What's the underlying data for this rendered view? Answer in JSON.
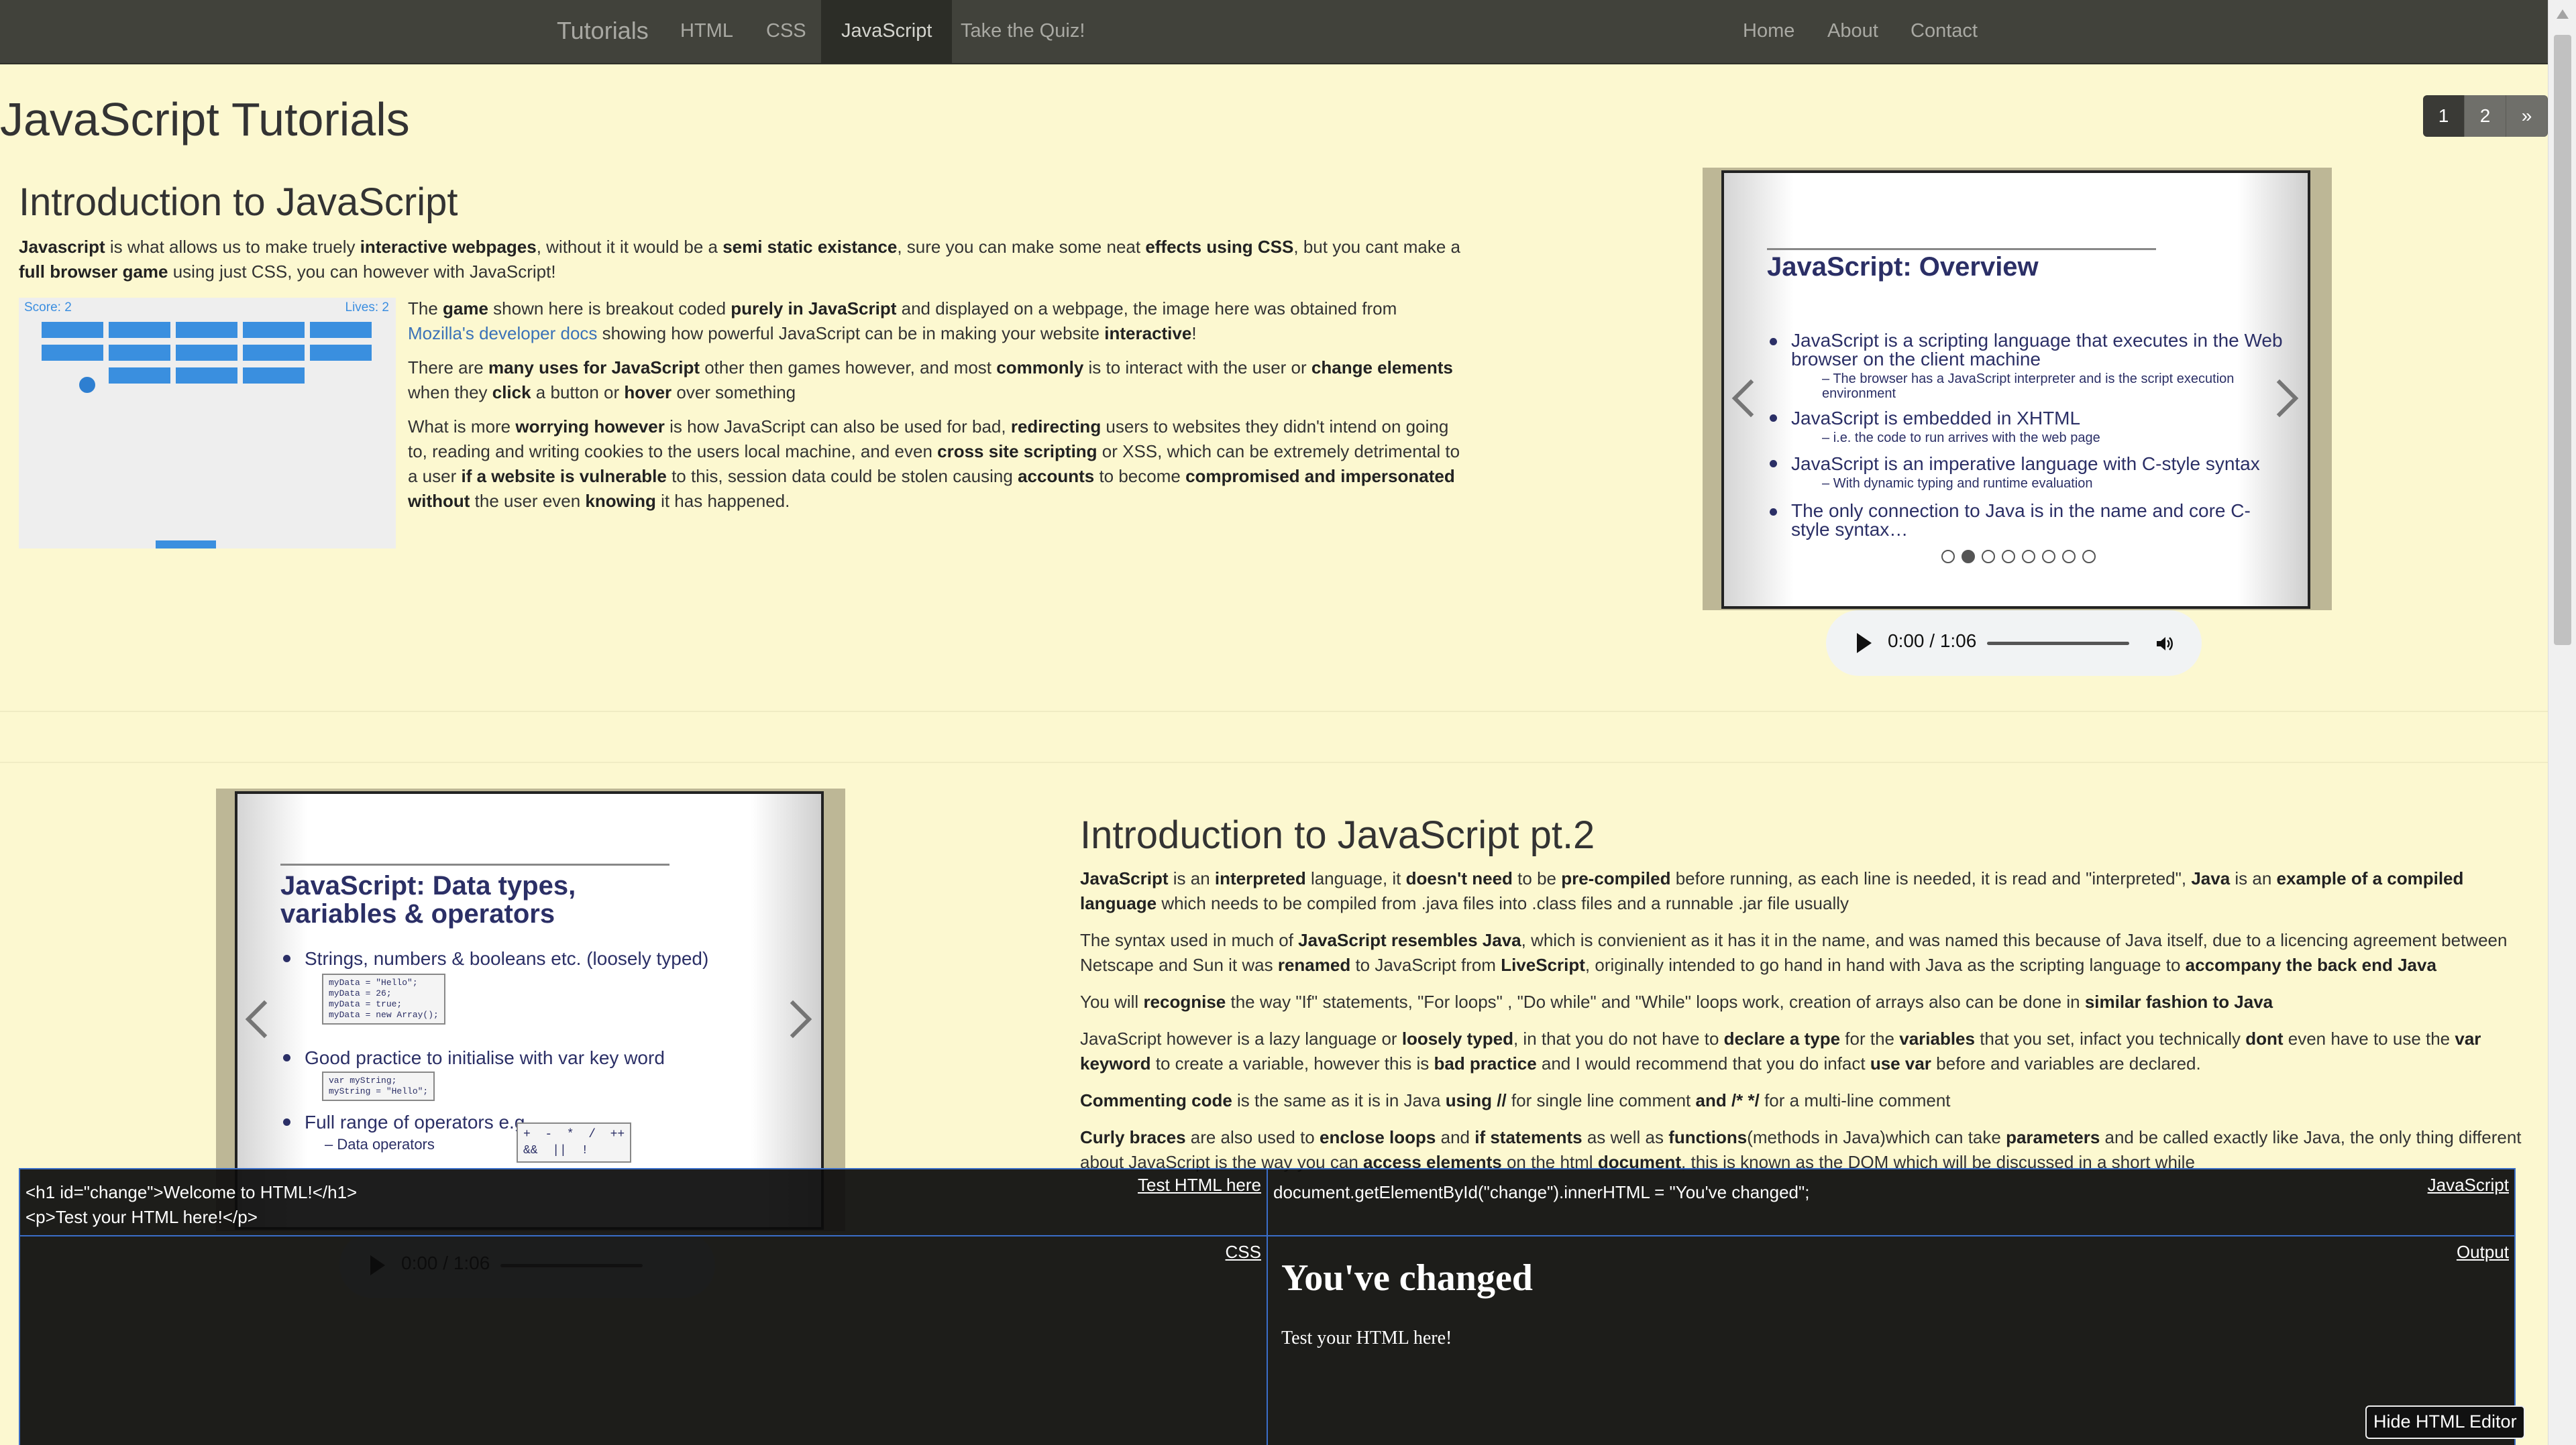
{
  "nav": {
    "brand": "Tutorials",
    "left_items": [
      "HTML",
      "CSS",
      "JavaScript",
      "Take the Quiz!"
    ],
    "active": "JavaScript",
    "right_items": [
      "Home",
      "About",
      "Contact"
    ]
  },
  "pagination": [
    "1",
    "2",
    "»"
  ],
  "page_title": "JavaScript Tutorials",
  "section1": {
    "heading": "Introduction to JavaScript",
    "game": {
      "score": "Score: 2",
      "lives": "Lives: 2"
    }
  },
  "slide1": {
    "title": "JavaScript: Overview",
    "bullets": [
      "JavaScript is a scripting language that executes in the Web browser on the client machine",
      "JavaScript is embedded in XHTML",
      "JavaScript is an imperative language with C-style syntax",
      "The only connection to Java is in the name and core C-style syntax…"
    ],
    "subs": [
      "The browser has a JavaScript interpreter and is the script execution environment",
      "i.e. the code to run arrives with the web page",
      "With dynamic typing and runtime evaluation"
    ]
  },
  "slide2": {
    "title_line1": "JavaScript: Data types,",
    "title_line2": "variables & operators",
    "bullets": [
      "Strings, numbers & booleans etc. (loosely typed)",
      "Good practice to initialise with var key word",
      "Full range of operators e.g"
    ],
    "code1": "myData = \"Hello\";\nmyData = 26;\nmyData = true;\nmyData = new Array();",
    "code2": "var myString;\nmyString = \"Hello\";",
    "sub": "Data operators",
    "ops": "+  -  *  /  ++\n&&  ||  !"
  },
  "audio": {
    "time": "0:00 / 1:06"
  },
  "section2": {
    "heading": "Introduction to JavaScript pt.2"
  },
  "editor": {
    "html_label": "Test HTML here",
    "html_code": "<h1 id=\"change\">Welcome to HTML!</h1>\n<p>Test your HTML here!</p>",
    "js_label": "JavaScript",
    "js_code": "document.getElementById(\"change\").innerHTML = \"You've changed\";",
    "css_label": "CSS",
    "output_label": "Output",
    "output_h1": "You've changed",
    "output_p": "Test your HTML here!",
    "hide_button": "Hide HTML Editor"
  }
}
